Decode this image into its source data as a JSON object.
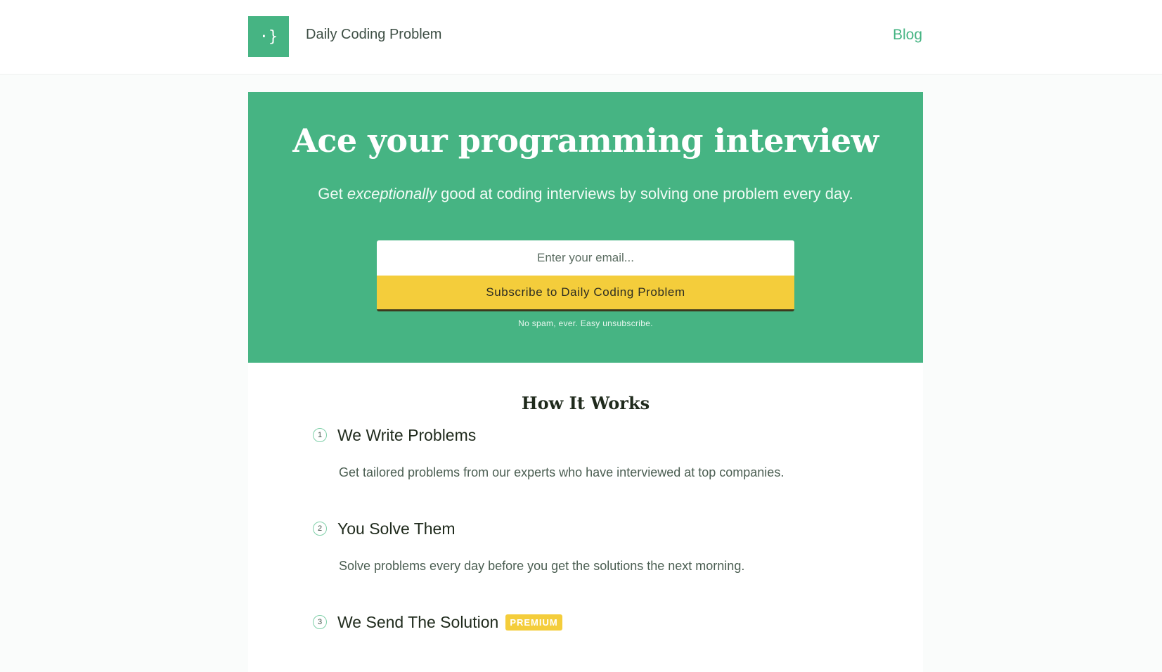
{
  "header": {
    "logo_glyph": "·}",
    "brand": "Daily Coding Problem",
    "nav_blog": "Blog"
  },
  "hero": {
    "title": "Ace your programming interview",
    "subtitle_before": "Get ",
    "subtitle_em": "exceptionally",
    "subtitle_after": " good at coding interviews by solving one problem every day.",
    "email_placeholder": "Enter your email...",
    "subscribe_label": "Subscribe to Daily Coding Problem",
    "no_spam": "No spam, ever. Easy unsubscribe."
  },
  "how_it_works": {
    "title": "How It Works",
    "steps": [
      {
        "number": "1",
        "title": "We Write Problems",
        "desc": "Get tailored problems from our experts who have interviewed at top companies."
      },
      {
        "number": "2",
        "title": "You Solve Them",
        "desc": "Solve problems every day before you get the solutions the next morning."
      },
      {
        "number": "3",
        "title": "We Send The Solution",
        "badge": "PREMIUM"
      }
    ]
  },
  "colors": {
    "brand_green": "#46b483",
    "button_yellow": "#f4cd3b"
  }
}
